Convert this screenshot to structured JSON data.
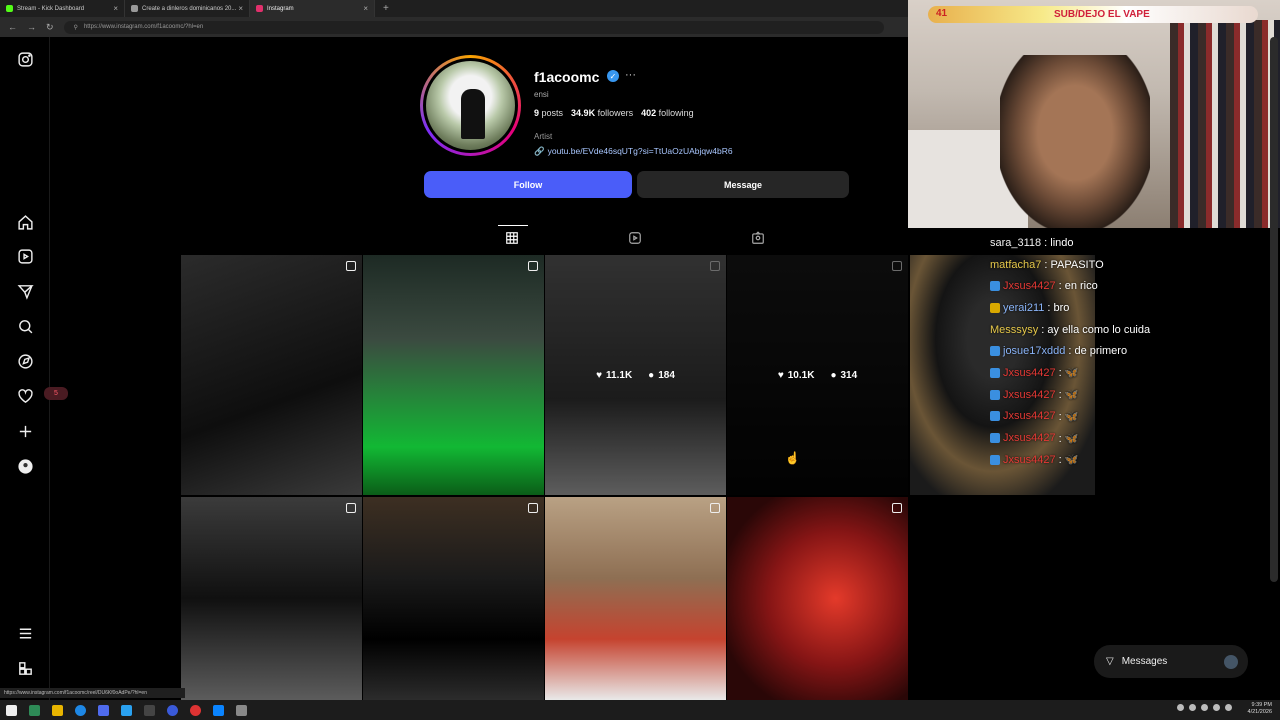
{
  "browser": {
    "tabs": [
      {
        "label": "Stream - Kick Dashboard",
        "color": "#53fc18"
      },
      {
        "label": "Create a dinleros dominicanos 20...",
        "color": "#999999"
      },
      {
        "label": "Instagram",
        "color": "#e1306c"
      }
    ],
    "new_tab": "+",
    "close": "×",
    "url": "https://www.instagram.com/f1acoomc/?hl=en",
    "status_url": "https://www.instagram.com/f1acoomc/reel/DU6Kf0oAdPe/?hl=en"
  },
  "profile": {
    "username": "f1acoomc",
    "verified": "✓",
    "more": "···",
    "nickname": "ensi",
    "posts_count": "9",
    "posts_label": "posts",
    "followers_count": "34.9K",
    "followers_label": "followers",
    "following_count": "402",
    "following_label": "following",
    "category": "Artist",
    "link": "youtu.be/EVde46sqUTg?si=TtUaOzUAbjqw4bR6",
    "follow_label": "Follow",
    "message_label": "Message"
  },
  "sidebar": {
    "notification_badge": "5"
  },
  "grid": {
    "posts": [
      {
        "bg": "linear-gradient(160deg,#2b2b2b,#0e0e0e 60%,#3a3a3a)",
        "type": "reel"
      },
      {
        "bg": "linear-gradient(180deg,#1d2a24 0%,#3b4a40 35%,#12b834 80%,#0b5d18 100%)",
        "type": "reel"
      },
      {
        "bg": "linear-gradient(180deg,#6d6d6d,#3d3d3d 60%,#cfcfcf)",
        "type": "reel",
        "likes": "11.1K",
        "comments": "184",
        "hover": true
      },
      {
        "bg": "linear-gradient(180deg,#1c1c1c,#050505)",
        "type": "reel",
        "likes": "10.1K",
        "comments": "314",
        "hover": true
      },
      {
        "bg": "linear-gradient(180deg,#3b3b3b,#101010 50%,#5c5c5c)",
        "type": "reel"
      },
      {
        "bg": "linear-gradient(180deg,#3d2f22,#1a1a1a 40%,#000 70%,#2c2c2c)",
        "type": "reel"
      },
      {
        "bg": "linear-gradient(180deg,#b9a184,#8e6f53 40%,#c5432f 70%,#e9e9e9)",
        "type": "reel"
      },
      {
        "bg": "radial-gradient(circle at 60% 50%,#e43a2a,#861515 45%,#2a0707 80%)",
        "type": "reel"
      }
    ]
  },
  "stream": {
    "goal_count": "41",
    "goal_text": "SUB/DEJO EL VAPE",
    "chat": [
      {
        "user": "sara_3118",
        "text": ": lindo",
        "color": "#f0f0f0",
        "badge": ""
      },
      {
        "user": "matfacha7",
        "text": ": PAPASITO",
        "color": "#e6c84a",
        "badge": ""
      },
      {
        "user": "Jxsus4427",
        "text": ": en rico",
        "color": "#e53935",
        "badge": "#3a8fe0"
      },
      {
        "user": "yerai211",
        "text": ": bro",
        "color": "#8ab4f8",
        "badge": "#d8a800"
      },
      {
        "user": "Messsysy",
        "text": ": ay ella como lo cuida",
        "color": "#e6c84a",
        "badge": ""
      },
      {
        "user": "josue17xddd",
        "text": ": de primero",
        "color": "#8ab4f8",
        "badge": "#3a8fe0"
      },
      {
        "user": "Jxsus4427",
        "text": ": 🦋",
        "color": "#e53935",
        "badge": "#3a8fe0"
      },
      {
        "user": "Jxsus4427",
        "text": ": 🦋",
        "color": "#e53935",
        "badge": "#3a8fe0"
      },
      {
        "user": "Jxsus4427",
        "text": ": 🦋",
        "color": "#e53935",
        "badge": "#3a8fe0"
      },
      {
        "user": "Jxsus4427",
        "text": ": 🦋",
        "color": "#e53935",
        "badge": "#3a8fe0"
      },
      {
        "user": "Jxsus4427",
        "text": ": 🦋",
        "color": "#e53935",
        "badge": "#3a8fe0"
      }
    ]
  },
  "messages_bar": {
    "label": "Messages"
  },
  "taskbar": {
    "time": "9:39 PM",
    "date": "4/21/2026"
  }
}
